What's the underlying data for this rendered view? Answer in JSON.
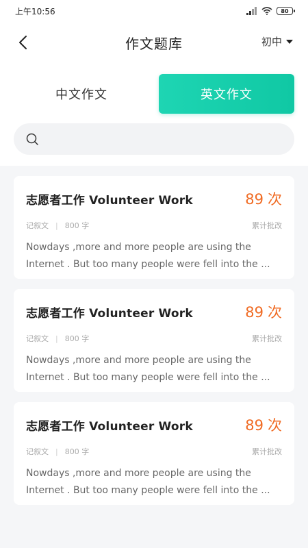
{
  "status_bar": {
    "time": "上午10:56",
    "battery": "80"
  },
  "header": {
    "title": "作文题库",
    "grade_select": "初中"
  },
  "tabs": [
    {
      "label": "中文作文",
      "active": false
    },
    {
      "label": "英文作文",
      "active": true
    }
  ],
  "search": {
    "placeholder": ""
  },
  "essays": [
    {
      "title": "志愿者工作 Volunteer Work",
      "count": "89",
      "count_unit": "次",
      "type": "记叙文",
      "words": "800 字",
      "right_label": "累计批改",
      "excerpt_line1": "Nowdays ,more and more people are using the",
      "excerpt_line2": "Internet . But too many people were fell into the ..."
    },
    {
      "title": "志愿者工作 Volunteer Work",
      "count": "89",
      "count_unit": "次",
      "type": "记叙文",
      "words": "800 字",
      "right_label": "累计批改",
      "excerpt_line1": "Nowdays ,more and more people are using the",
      "excerpt_line2": "Internet . But too many people were fell into the ..."
    },
    {
      "title": "志愿者工作 Volunteer Work",
      "count": "89",
      "count_unit": "次",
      "type": "记叙文",
      "words": "800 字",
      "right_label": "累计批改",
      "excerpt_line1": "Nowdays ,more and more people are using the",
      "excerpt_line2": "Internet . But too many people were fell into the ..."
    }
  ],
  "colors": {
    "accent": "#13cda9",
    "count": "#f06a22",
    "background": "#f5f6f8"
  }
}
